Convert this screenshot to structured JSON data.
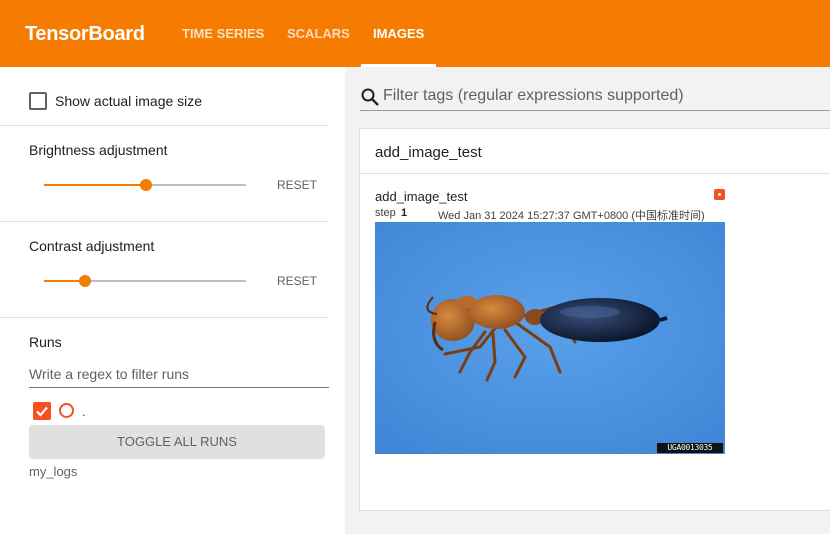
{
  "app": {
    "title": "TensorBoard"
  },
  "nav": {
    "tabs": [
      {
        "label": "TIME SERIES",
        "active": false
      },
      {
        "label": "SCALARS",
        "active": false
      },
      {
        "label": "IMAGES",
        "active": true
      }
    ]
  },
  "sidebar": {
    "show_actual_size": {
      "label": "Show actual image size",
      "checked": false
    },
    "brightness": {
      "label": "Brightness adjustment",
      "reset_label": "RESET",
      "level": 0.5
    },
    "contrast": {
      "label": "Contrast adjustment",
      "reset_label": "RESET",
      "level": 0.2
    },
    "runs": {
      "title": "Runs",
      "filter_placeholder": "Write a regex to filter runs",
      "run_dot_label": ".",
      "toggle_all_label": "TOGGLE ALL RUNS",
      "run_name": "my_logs",
      "run_color": "#f4511e"
    }
  },
  "main": {
    "tag_filter_placeholder": "Filter tags (regular expressions supported)",
    "group": {
      "title": "add_image_test",
      "card": {
        "title": "add_image_test",
        "step_label": "step",
        "step_value": "1",
        "timestamp": "Wed Jan 31 2024 15:27:37 GMT+0800 (中国标准时间)",
        "image_watermark": "UGA0013035"
      }
    }
  },
  "colors": {
    "accent": "#f57c00",
    "run": "#f4511e",
    "image_background": "#4a90e2"
  }
}
